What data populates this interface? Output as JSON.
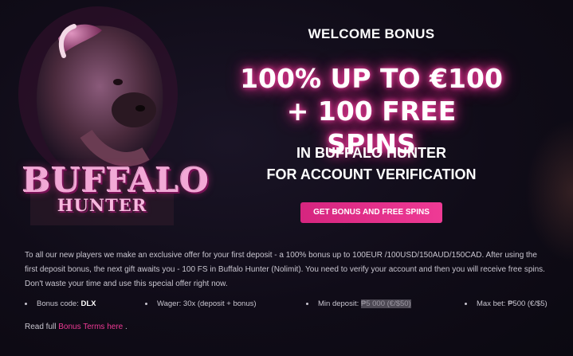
{
  "promo": {
    "welcome": "WELCOME BONUS",
    "headline_line1": "100% UP TO €100",
    "headline_line2": "+ 100 FREE SPINS",
    "sub_line1": "IN BUFFALO HUNTER",
    "sub_line2": "FOR ACCOUNT VERIFICATION",
    "cta_label": "GET BONUS AND FREE SPINS"
  },
  "game_logo": {
    "line1": "BUFFALO",
    "line2": "HUNTER"
  },
  "description": "To all our new players we make an exclusive offer for your first deposit - a 100% bonus up to 100EUR /100USD/150AUD/150CAD. After using the first deposit bonus, the next gift awaits you - 100 FS in Buffalo Hunter (Nolimit). You need to verify your account and then you will receive free spins. Don't waste your time and use this special offer right now.",
  "details": {
    "code_label": "Bonus code: ",
    "code_value": "DLX",
    "wager": "Wager: 30x (deposit + bonus)",
    "min_deposit_label": "Min deposit: ",
    "min_deposit_value": "₱5 000 (€/$50)",
    "max_bet": "Max bet: ₱500 (€/$5)"
  },
  "terms": {
    "prefix": "Read full ",
    "link": "Bonus Terms here",
    "suffix": " ."
  },
  "colors": {
    "accent": "#ef3a95",
    "background": "#100c18"
  }
}
